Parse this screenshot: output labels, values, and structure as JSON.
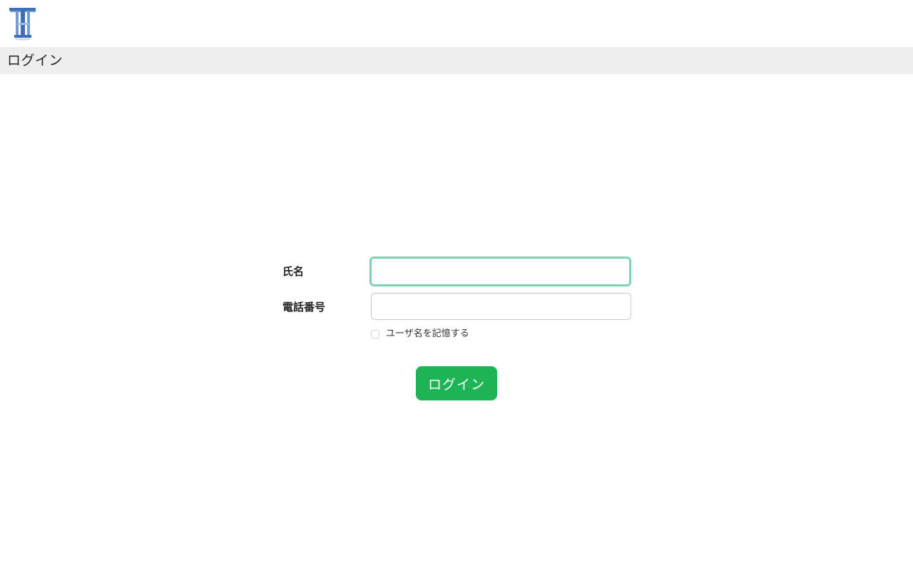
{
  "header": {
    "logo_icon": "tt-logo-icon"
  },
  "titlebar": {
    "title": "ログイン"
  },
  "form": {
    "name_label": "氏名",
    "name_value": "",
    "phone_label": "電話番号",
    "phone_value": "",
    "remember_label": "ユーザ名を記憶する",
    "remember_checked": false,
    "submit_label": "ログイン"
  },
  "colors": {
    "button": "#1db455",
    "focus_ring": "#7fd3b1",
    "titlebar_bg": "#eeeeee",
    "logo": "#3f6fb5"
  }
}
